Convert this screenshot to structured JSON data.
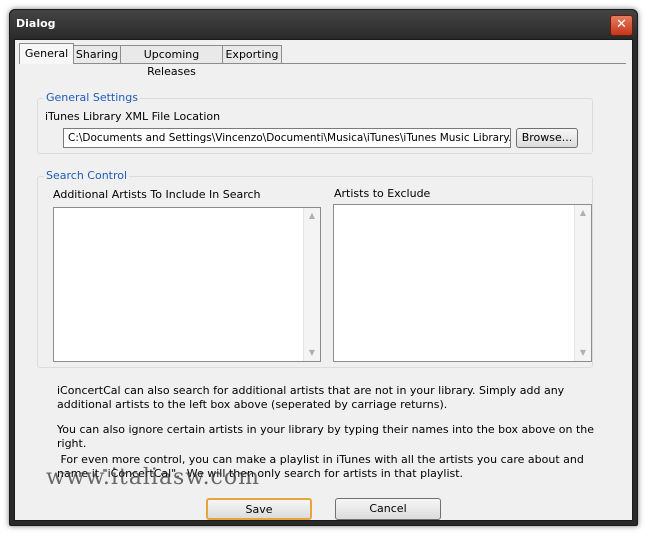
{
  "window": {
    "title": "Dialog",
    "close_glyph": "✕"
  },
  "tabs": [
    {
      "label": "General",
      "active": true
    },
    {
      "label": "Sharing",
      "active": false
    },
    {
      "label": "Upcoming Releases",
      "active": false
    },
    {
      "label": "Exporting",
      "active": false
    }
  ],
  "general_settings": {
    "legend": "General Settings",
    "xml_label": "iTunes Library XML File Location",
    "xml_path": "C:\\Documents and Settings\\Vincenzo\\Documenti\\Musica\\iTunes\\iTunes Music Library.xml",
    "browse_label": "Browse..."
  },
  "search_control": {
    "legend": "Search Control",
    "include_label": "Additional Artists To Include In Search",
    "exclude_label": "Artists to Exclude"
  },
  "help": {
    "p1": "iConcertCal can also search for additional artists that are not in your library.  Simply add any additional artists to the left box above (seperated by carriage returns).",
    "p2": "You can also ignore certain artists in your library by typing their names into the box above on the right.",
    "p3": " For even more control, you can make a playlist in iTunes with all the artists you care about and name it \"iConcertCal\".  We will then only search for artists in that playlist."
  },
  "buttons": {
    "save": "Save",
    "cancel": "Cancel"
  },
  "watermark": "www.italiasw.com",
  "colors": {
    "legend": "#1f5bb8",
    "titlebar": "#2b2b2b",
    "close": "#c3361a",
    "default_button_border": "#e8a33c"
  }
}
